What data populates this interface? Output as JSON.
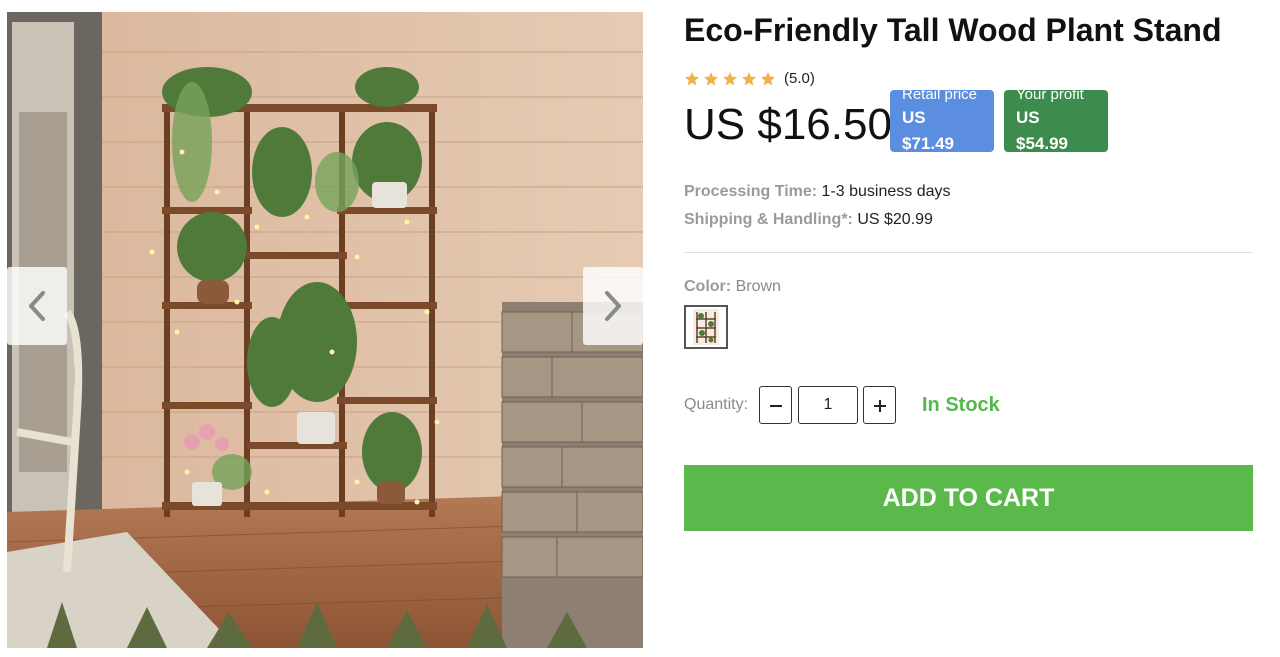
{
  "product": {
    "title": "Eco-Friendly Tall Wood Plant Stand",
    "rating": {
      "stars": 5,
      "value_text": "(5.0)",
      "star_color": "#f2b24a"
    },
    "price": "US $16.50",
    "retail": {
      "label": "Retail price",
      "value": "US $71.49",
      "color": "#5b8de0"
    },
    "profit": {
      "label": "Your profit",
      "value": "US $54.99",
      "color": "#3d8c4e"
    },
    "processing": {
      "label": "Processing Time:",
      "value": "1-3 business days"
    },
    "shipping": {
      "label": "Shipping & Handling*:",
      "value": "US $20.99"
    },
    "color": {
      "label": "Color:",
      "value": "Brown"
    },
    "quantity": {
      "label": "Quantity:",
      "value": "1",
      "minus_icon": "minus-icon",
      "plus_icon": "plus-icon"
    },
    "stock_status": "In Stock",
    "add_to_cart_label": "ADD TO CART"
  },
  "gallery": {
    "prev_icon": "chevron-left-icon",
    "next_icon": "chevron-right-icon"
  },
  "colors": {
    "accent_green": "#5ab94a",
    "stock_green": "#55b94a"
  }
}
